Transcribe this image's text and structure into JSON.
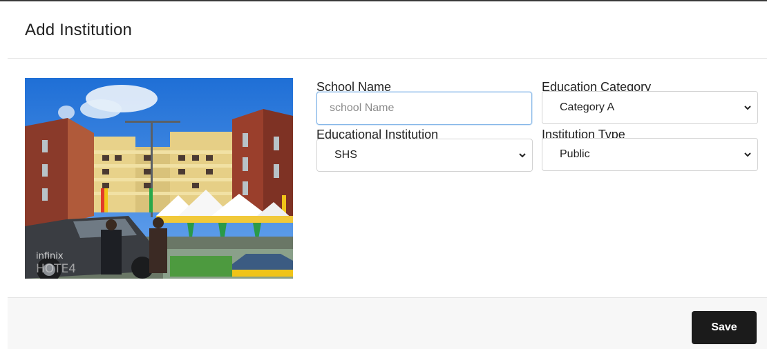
{
  "modal": {
    "title": "Add Institution"
  },
  "photo": {
    "watermark_line1": "infinix",
    "watermark_line2": "HOTE4"
  },
  "form": {
    "school_name": {
      "label": "School Name",
      "placeholder": "school Name",
      "value": ""
    },
    "education_category": {
      "label": "Education Category",
      "selected": "Category A"
    },
    "educational_institution": {
      "label": "Educational Institution",
      "selected": "SHS"
    },
    "institution_type": {
      "label": "Institution Type",
      "selected": "Public"
    }
  },
  "footer": {
    "save_label": "Save"
  },
  "icons": {
    "dropdown": "chevron-down-icon"
  }
}
